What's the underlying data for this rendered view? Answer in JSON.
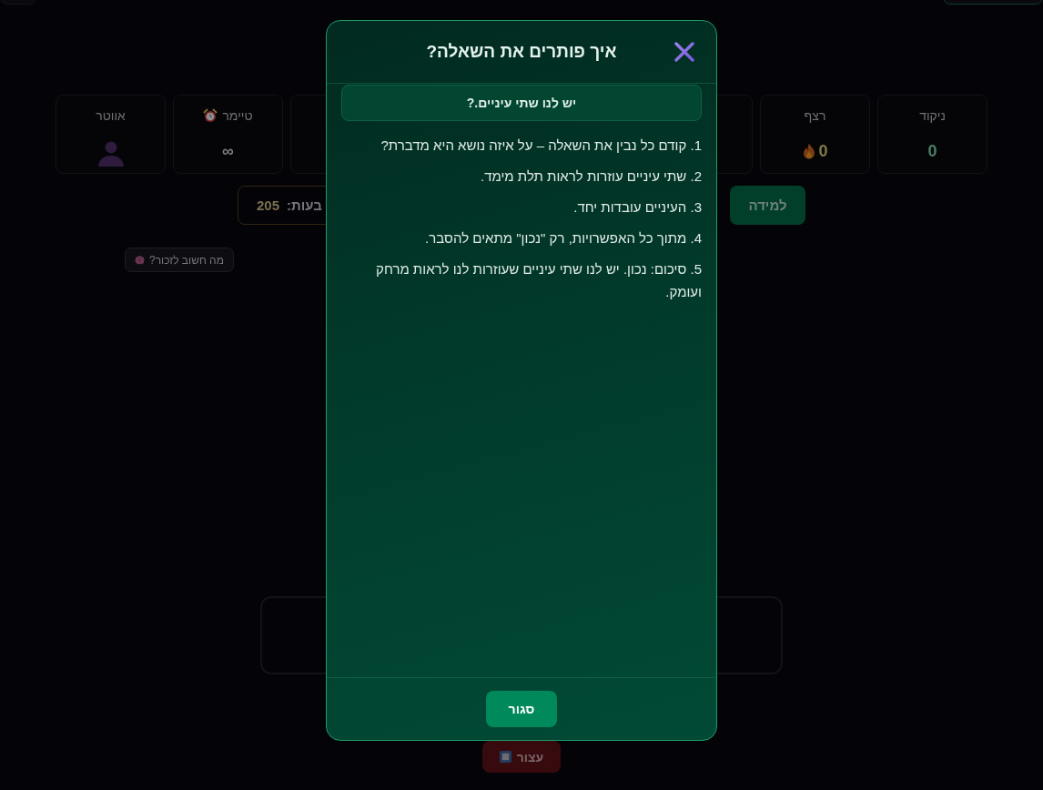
{
  "stats": [
    {
      "kind": "score",
      "label": "ניקוד",
      "value": "0"
    },
    {
      "kind": "streak",
      "label": "רצף",
      "value": "0"
    },
    {
      "kind": "timer",
      "label": "טיימר",
      "value": "∞"
    },
    {
      "kind": "avatar",
      "label": "אווטר"
    }
  ],
  "actions": {
    "learn_button": "למידה",
    "coins": {
      "label": "בעות:",
      "value": "205"
    }
  },
  "memory_chip": "מה חשוב לזכור?",
  "stop_button": "עצור",
  "modal": {
    "title": "איך פותרים את השאלה?",
    "subtitle": "יש לנו שתי עיניים.?",
    "steps": [
      "1. קודם כל נבין את השאלה – על איזה נושא היא מדברת?",
      "2. שתי עיניים עוזרות לראות תלת מימד.",
      "3. העיניים עובדות יחד.",
      "4. מתוך כל האפשרויות, רק \"נכון\" מתאים להסבר.",
      "5. סיכום: נכון. יש לנו שתי עיניים שעוזרות לנו לראות מרחק ועומק."
    ],
    "close_button": "סגור"
  }
}
